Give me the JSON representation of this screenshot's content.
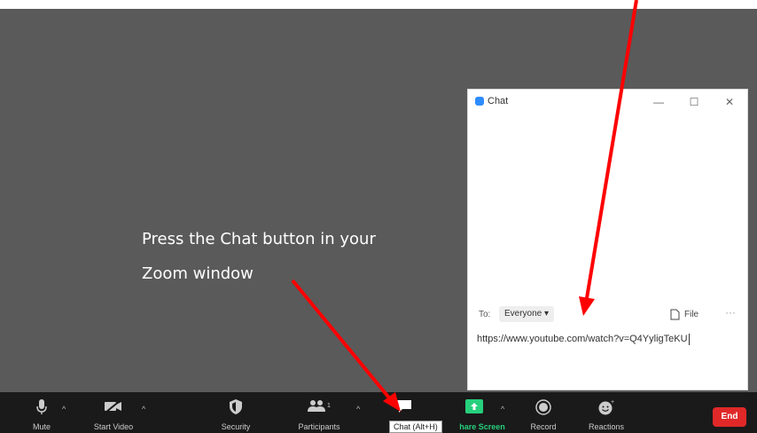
{
  "instruction": {
    "line1": "Press the Chat button in your",
    "line2": "Zoom window"
  },
  "chat_window": {
    "title": "Chat",
    "minimize_glyph": "—",
    "maximize_glyph": "☐",
    "close_glyph": "✕",
    "to_label": "To:",
    "recipient": "Everyone ▾",
    "file_label": "File",
    "more_glyph": "···",
    "message_value": "https://www.youtube.com/watch?v=Q4YyligTeKU"
  },
  "toolbar": {
    "items": [
      {
        "label": "Mute",
        "icon": "microphone-icon"
      },
      {
        "label": "Start Video",
        "icon": "video-camera-off-icon"
      },
      {
        "label": "Security",
        "icon": "shield-icon"
      },
      {
        "label": "Participants",
        "icon": "participants-icon",
        "count": "1"
      },
      {
        "label": "Chat (Alt+H)",
        "icon": "chat-bubble-icon"
      },
      {
        "label": "hare Screen",
        "icon": "share-screen-icon"
      },
      {
        "label": "Record",
        "icon": "record-icon"
      },
      {
        "label": "Reactions",
        "icon": "reactions-icon"
      }
    ],
    "end_label": "End"
  },
  "colors": {
    "meeting_bg": "#5a5a5a",
    "toolbar_bg": "#1a1a1a",
    "share_green": "#26d07c",
    "end_red": "#e02828",
    "arrow_red": "#ff0000",
    "zoom_blue": "#2d8cff"
  }
}
